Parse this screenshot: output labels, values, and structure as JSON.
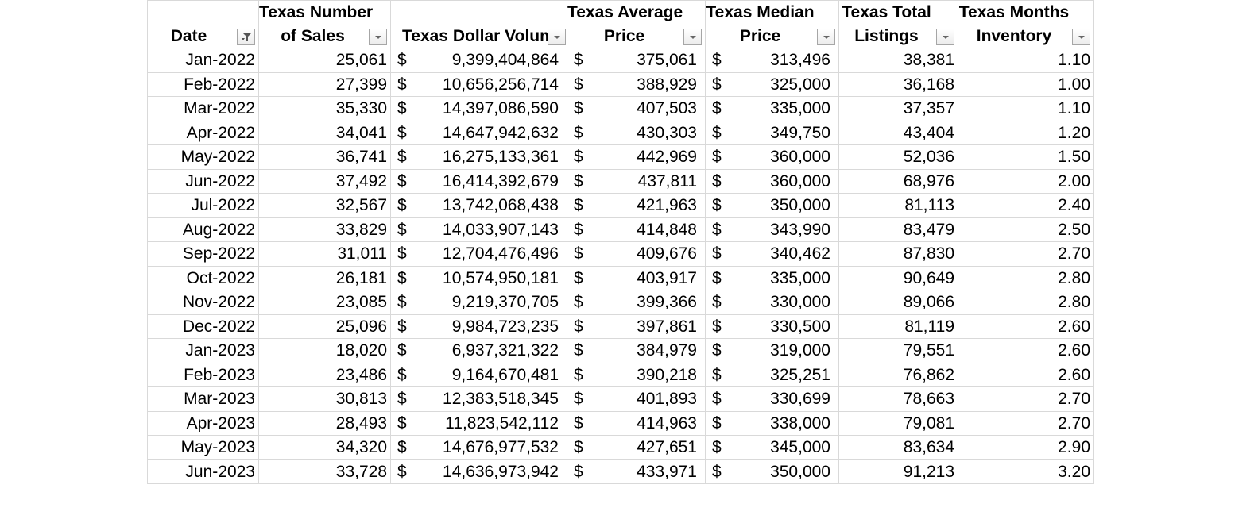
{
  "table": {
    "headers": [
      {
        "line1": "",
        "line2": "Date",
        "filter_active": true
      },
      {
        "line1": "Texas Number",
        "line2": "of Sales",
        "filter_active": false
      },
      {
        "line1": "",
        "line2": "Texas Dollar Volum",
        "filter_active": false
      },
      {
        "line1": "Texas Average",
        "line2": "Price",
        "filter_active": false
      },
      {
        "line1": "Texas Median",
        "line2": "Price",
        "filter_active": false
      },
      {
        "line1": "Texas Total",
        "line2": "Listings",
        "filter_active": false
      },
      {
        "line1": "Texas Months",
        "line2": "Inventory",
        "filter_active": false
      }
    ],
    "currency_symbol": "$",
    "rows": [
      {
        "date": "Jan-2022",
        "sales": "25,061",
        "volume": "9,399,404,864",
        "avg": "375,061",
        "median": "313,496",
        "listings": "38,381",
        "inventory": "1.10"
      },
      {
        "date": "Feb-2022",
        "sales": "27,399",
        "volume": "10,656,256,714",
        "avg": "388,929",
        "median": "325,000",
        "listings": "36,168",
        "inventory": "1.00"
      },
      {
        "date": "Mar-2022",
        "sales": "35,330",
        "volume": "14,397,086,590",
        "avg": "407,503",
        "median": "335,000",
        "listings": "37,357",
        "inventory": "1.10"
      },
      {
        "date": "Apr-2022",
        "sales": "34,041",
        "volume": "14,647,942,632",
        "avg": "430,303",
        "median": "349,750",
        "listings": "43,404",
        "inventory": "1.20"
      },
      {
        "date": "May-2022",
        "sales": "36,741",
        "volume": "16,275,133,361",
        "avg": "442,969",
        "median": "360,000",
        "listings": "52,036",
        "inventory": "1.50"
      },
      {
        "date": "Jun-2022",
        "sales": "37,492",
        "volume": "16,414,392,679",
        "avg": "437,811",
        "median": "360,000",
        "listings": "68,976",
        "inventory": "2.00"
      },
      {
        "date": "Jul-2022",
        "sales": "32,567",
        "volume": "13,742,068,438",
        "avg": "421,963",
        "median": "350,000",
        "listings": "81,113",
        "inventory": "2.40"
      },
      {
        "date": "Aug-2022",
        "sales": "33,829",
        "volume": "14,033,907,143",
        "avg": "414,848",
        "median": "343,990",
        "listings": "83,479",
        "inventory": "2.50"
      },
      {
        "date": "Sep-2022",
        "sales": "31,011",
        "volume": "12,704,476,496",
        "avg": "409,676",
        "median": "340,462",
        "listings": "87,830",
        "inventory": "2.70"
      },
      {
        "date": "Oct-2022",
        "sales": "26,181",
        "volume": "10,574,950,181",
        "avg": "403,917",
        "median": "335,000",
        "listings": "90,649",
        "inventory": "2.80"
      },
      {
        "date": "Nov-2022",
        "sales": "23,085",
        "volume": "9,219,370,705",
        "avg": "399,366",
        "median": "330,000",
        "listings": "89,066",
        "inventory": "2.80"
      },
      {
        "date": "Dec-2022",
        "sales": "25,096",
        "volume": "9,984,723,235",
        "avg": "397,861",
        "median": "330,500",
        "listings": "81,119",
        "inventory": "2.60"
      },
      {
        "date": "Jan-2023",
        "sales": "18,020",
        "volume": "6,937,321,322",
        "avg": "384,979",
        "median": "319,000",
        "listings": "79,551",
        "inventory": "2.60"
      },
      {
        "date": "Feb-2023",
        "sales": "23,486",
        "volume": "9,164,670,481",
        "avg": "390,218",
        "median": "325,251",
        "listings": "76,862",
        "inventory": "2.60"
      },
      {
        "date": "Mar-2023",
        "sales": "30,813",
        "volume": "12,383,518,345",
        "avg": "401,893",
        "median": "330,699",
        "listings": "78,663",
        "inventory": "2.70"
      },
      {
        "date": "Apr-2023",
        "sales": "28,493",
        "volume": "11,823,542,112",
        "avg": "414,963",
        "median": "338,000",
        "listings": "79,081",
        "inventory": "2.70"
      },
      {
        "date": "May-2023",
        "sales": "34,320",
        "volume": "14,676,977,532",
        "avg": "427,651",
        "median": "345,000",
        "listings": "83,634",
        "inventory": "2.90"
      },
      {
        "date": "Jun-2023",
        "sales": "33,728",
        "volume": "14,636,973,942",
        "avg": "433,971",
        "median": "350,000",
        "listings": "91,213",
        "inventory": "3.20"
      }
    ]
  }
}
